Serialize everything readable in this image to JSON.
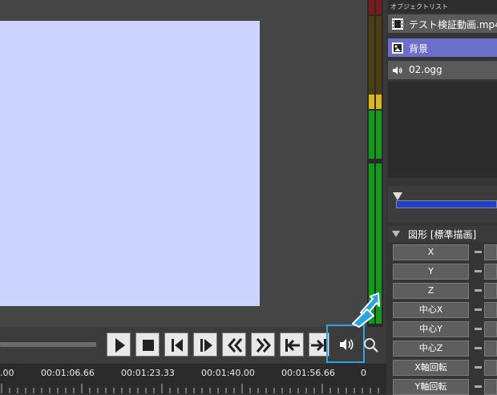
{
  "preview": {
    "canvas_color": "#cdd4ff"
  },
  "object_list": {
    "title": "オブジェクトリスト",
    "items": [
      {
        "label": "テスト検証動画.mp4",
        "icon": "film-icon",
        "selected": false
      },
      {
        "label": "背景",
        "icon": "image-icon",
        "selected": true
      },
      {
        "label": "02.ogg",
        "icon": "speaker-icon",
        "selected": false
      }
    ]
  },
  "transport": {
    "buttons": [
      {
        "name": "play-button",
        "icon": "play-icon"
      },
      {
        "name": "stop-button",
        "icon": "stop-icon"
      },
      {
        "name": "prev-frame-button",
        "icon": "step-back-icon"
      },
      {
        "name": "next-frame-button",
        "icon": "step-forward-icon"
      },
      {
        "name": "rewind-button",
        "icon": "rewind-icon"
      },
      {
        "name": "fast-forward-button",
        "icon": "fast-forward-icon"
      },
      {
        "name": "go-to-start-button",
        "icon": "skip-start-icon"
      },
      {
        "name": "go-to-end-button",
        "icon": "skip-end-icon"
      },
      {
        "name": "mute-button",
        "icon": "speaker-icon",
        "highlighted": true
      }
    ]
  },
  "timeline": {
    "labels": [
      ".00",
      "00:01:06.66",
      "00:01:23.33",
      "00:01:40.00",
      "00:01:56.66",
      "0"
    ]
  },
  "properties": {
    "title": "図形 [標準描画]",
    "buttons": [
      "X",
      "Y",
      "Z",
      "中心X",
      "中心Y",
      "中心Z",
      "X軸回転",
      "Y軸回転"
    ]
  },
  "colors": {
    "accent": "#29a3e3",
    "selected_item": "#6b6fc8",
    "slider_fill": "#2240c8",
    "meter_green": "#119a1c",
    "meter_yellow": "#d8b81a",
    "meter_red": "#7a1a1a"
  }
}
